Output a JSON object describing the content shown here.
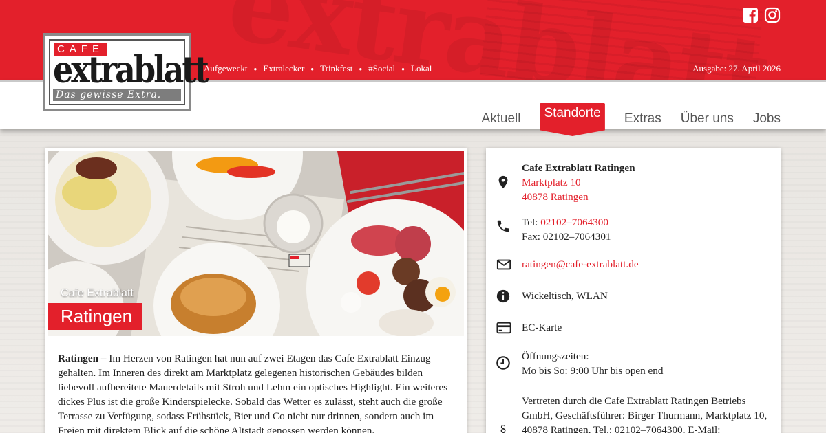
{
  "brand": {
    "cafe": "CAFE",
    "name": "extrablatt",
    "slogan": "Das gewisse Extra."
  },
  "tagline_links": [
    "Aufgeweckt",
    "Extralecker",
    "Trinkfest",
    "#Social",
    "Lokal"
  ],
  "edition": "Ausgabe: 27. April 2026",
  "nav": {
    "items": [
      "Aktuell",
      "Standorte",
      "Extras",
      "Über uns",
      "Jobs"
    ],
    "active": "Standorte"
  },
  "hero": {
    "small": "Cafe Extrablatt",
    "big": "Ratingen"
  },
  "description": {
    "lead": "Ratingen",
    "text": " – Im Herzen von Ratingen hat nun auf zwei Etagen das Cafe Extrablatt Einzug gehalten. Im Inneren des direkt am Marktplatz gelegenen historischen Gebäudes bilden liebevoll aufbereitete Mauerdetails mit Stroh und Lehm ein optisches Highlight. Ein weiteres dickes Plus ist die große Kinderspielecke. Sobald das Wetter es zulässt, steht auch die große Terrasse zu Verfügung, sodass Frühstück, Bier und Co nicht nur drinnen, sondern auch im Freien mit direktem Blick auf die schöne Altstadt genossen werden können."
  },
  "location": {
    "name": "Cafe Extrablatt Ratingen",
    "street": "Marktplatz 10",
    "city": "40878 Ratingen",
    "tel_label": "Tel: ",
    "tel": "02102–7064300",
    "fax": "Fax: 02102–7064301",
    "email": "ratingen@cafe-extrablatt.de",
    "features": "Wickeltisch, WLAN",
    "payment": "EC-Karte",
    "hours_label": "Öffnungszeiten:",
    "hours": "Mo bis So: 9:00 Uhr bis open end",
    "legal": "Vertreten durch die Cafe Extrablatt Ratingen Betriebs GmbH, Geschäftsführer: Birger Thurmann, Marktplatz 10, 40878 Ratingen, Tel.: 02102–7064300, E-Mail:"
  },
  "icons": [
    "facebook-icon",
    "instagram-icon",
    "map-pin-icon",
    "phone-icon",
    "mail-icon",
    "info-icon",
    "credit-card-icon",
    "clock-icon",
    "paragraph-icon"
  ],
  "colors": {
    "brand_red": "#e3202b",
    "text": "#222222",
    "nav_text": "#555555"
  }
}
